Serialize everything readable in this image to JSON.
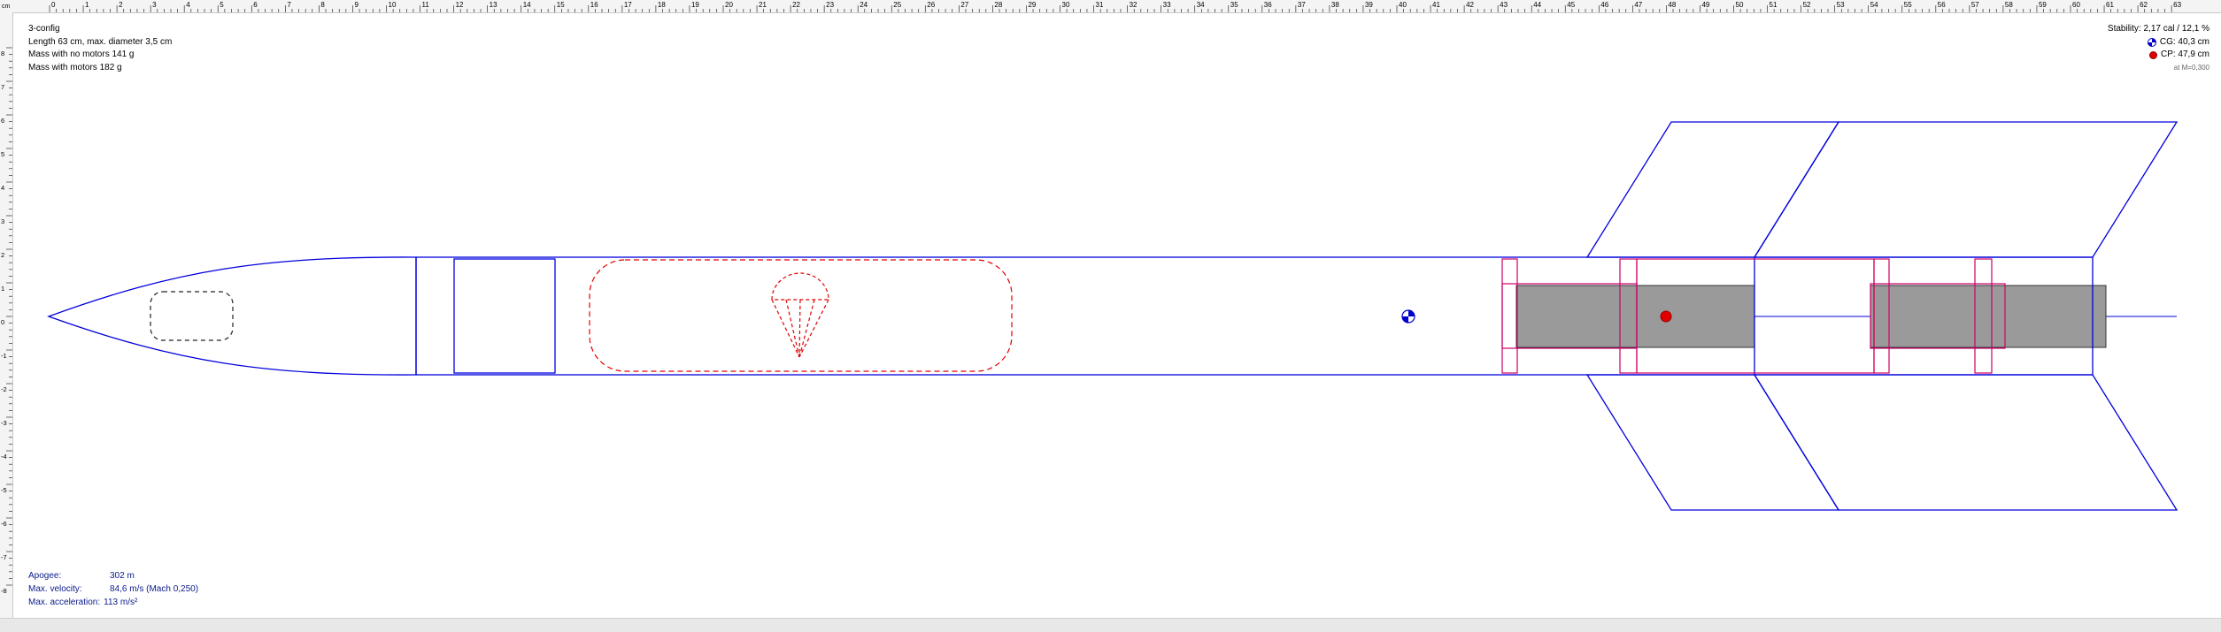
{
  "ruler": {
    "unit": "cm",
    "top_ticks": [
      "0",
      "1",
      "2",
      "3",
      "4",
      "5",
      "6",
      "7",
      "8",
      "9",
      "10",
      "11",
      "12",
      "13",
      "14",
      "15",
      "16",
      "17",
      "18",
      "19",
      "20",
      "21",
      "22",
      "23",
      "24",
      "25",
      "26",
      "27",
      "28",
      "29",
      "30",
      "31",
      "32",
      "33",
      "34",
      "35",
      "36",
      "37",
      "38",
      "39",
      "40",
      "41",
      "42",
      "43",
      "44",
      "45",
      "46",
      "47",
      "48",
      "49",
      "50",
      "51",
      "52",
      "53",
      "54",
      "55",
      "56",
      "57",
      "58",
      "59",
      "60",
      "61",
      "62",
      "63"
    ],
    "left_ticks": [
      "8",
      "7",
      "6",
      "5",
      "4",
      "3",
      "2",
      "1",
      "0",
      "-1",
      "-2",
      "-3",
      "-4",
      "-5",
      "-6",
      "-7",
      "-8"
    ]
  },
  "design": {
    "name": "3-config",
    "length_line": "Length 63 cm, max. diameter 3,5 cm",
    "mass_no_motors": "Mass with no motors 141 g",
    "mass_with_motors": "Mass with motors 182 g"
  },
  "stability": {
    "summary": "Stability: 2,17 cal / 12,1 %",
    "cg": "CG: 40,3 cm",
    "cp": "CP: 47,9 cm",
    "mach": "at M=0,300"
  },
  "flight": {
    "apogee_label": "Apogee:",
    "apogee_value": "302 m",
    "velocity_label": "Max. velocity:",
    "velocity_value": "84,6 m/s  (Mach 0,250)",
    "accel_label": "Max. acceleration:",
    "accel_value": "113 m/s²"
  },
  "colors": {
    "body_outline": "#0000dd",
    "recovery": "#e00000",
    "motor_mount": "#cc0066",
    "motor_fill": "#9a9a9a",
    "cp_marker": "#e00000",
    "cg_marker": "#0000cc"
  }
}
